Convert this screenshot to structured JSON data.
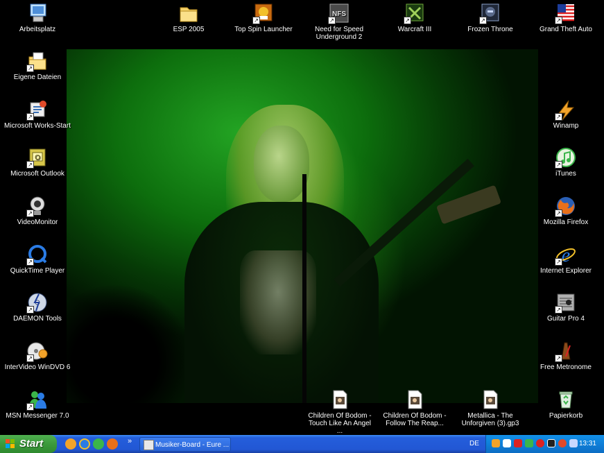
{
  "desktop": {
    "left_icons": [
      {
        "label": "Arbeitsplatz",
        "icon": "computer-icon"
      },
      {
        "label": "Eigene Dateien",
        "icon": "my-documents-icon"
      },
      {
        "label": "Microsoft Works-Start",
        "icon": "works-icon"
      },
      {
        "label": "Microsoft Outlook",
        "icon": "outlook-icon"
      },
      {
        "label": "VideoMonitor",
        "icon": "webcam-icon"
      },
      {
        "label": "QuickTime Player",
        "icon": "quicktime-icon"
      },
      {
        "label": "DAEMON Tools",
        "icon": "daemon-tools-icon"
      },
      {
        "label": "InterVideo WinDVD 6",
        "icon": "windvd-icon"
      },
      {
        "label": "MSN Messenger 7.0",
        "icon": "msn-icon"
      }
    ],
    "top_icons": [
      {
        "label": "ESP 2005",
        "icon": "folder-icon"
      },
      {
        "label": "Top Spin Launcher",
        "icon": "topspin-icon"
      },
      {
        "label": "Need for Speed Underground 2",
        "icon": "nfs-icon"
      },
      {
        "label": "Warcraft III",
        "icon": "warcraft-icon"
      },
      {
        "label": "Frozen Throne",
        "icon": "frozen-throne-icon"
      },
      {
        "label": "Grand Theft Auto",
        "icon": "gta-icon"
      }
    ],
    "right_icons": [
      {
        "label": "Winamp",
        "icon": "winamp-icon"
      },
      {
        "label": "iTunes",
        "icon": "itunes-icon"
      },
      {
        "label": "Mozilla Firefox",
        "icon": "firefox-icon"
      },
      {
        "label": "Internet Explorer",
        "icon": "ie-icon"
      },
      {
        "label": "Guitar Pro 4",
        "icon": "guitar-pro-icon"
      },
      {
        "label": "Free Metronome",
        "icon": "metronome-icon"
      },
      {
        "label": "Papierkorb",
        "icon": "recycle-bin-icon"
      }
    ],
    "bottom_icons": [
      {
        "label": "Children Of Bodom - Touch Like An Angel ...",
        "icon": "file-icon"
      },
      {
        "label": "Children Of Bodom - Follow The Reap...",
        "icon": "file-icon"
      },
      {
        "label": "Metallica - The Unforgiven (3).gp3",
        "icon": "file-icon"
      }
    ]
  },
  "taskbar": {
    "start_label": "Start",
    "quick_launch": [
      "quicklaunch-icon",
      "ie-icon",
      "refresh-icon",
      "firefox-icon"
    ],
    "expand_label": "»",
    "task_label": "Musiker-Board - Eure ...",
    "language": "DE",
    "clock": "13:31"
  },
  "colors": {
    "taskbar": "#245edb",
    "start": "#3c9a3c",
    "tray": "#0f7fd8"
  }
}
